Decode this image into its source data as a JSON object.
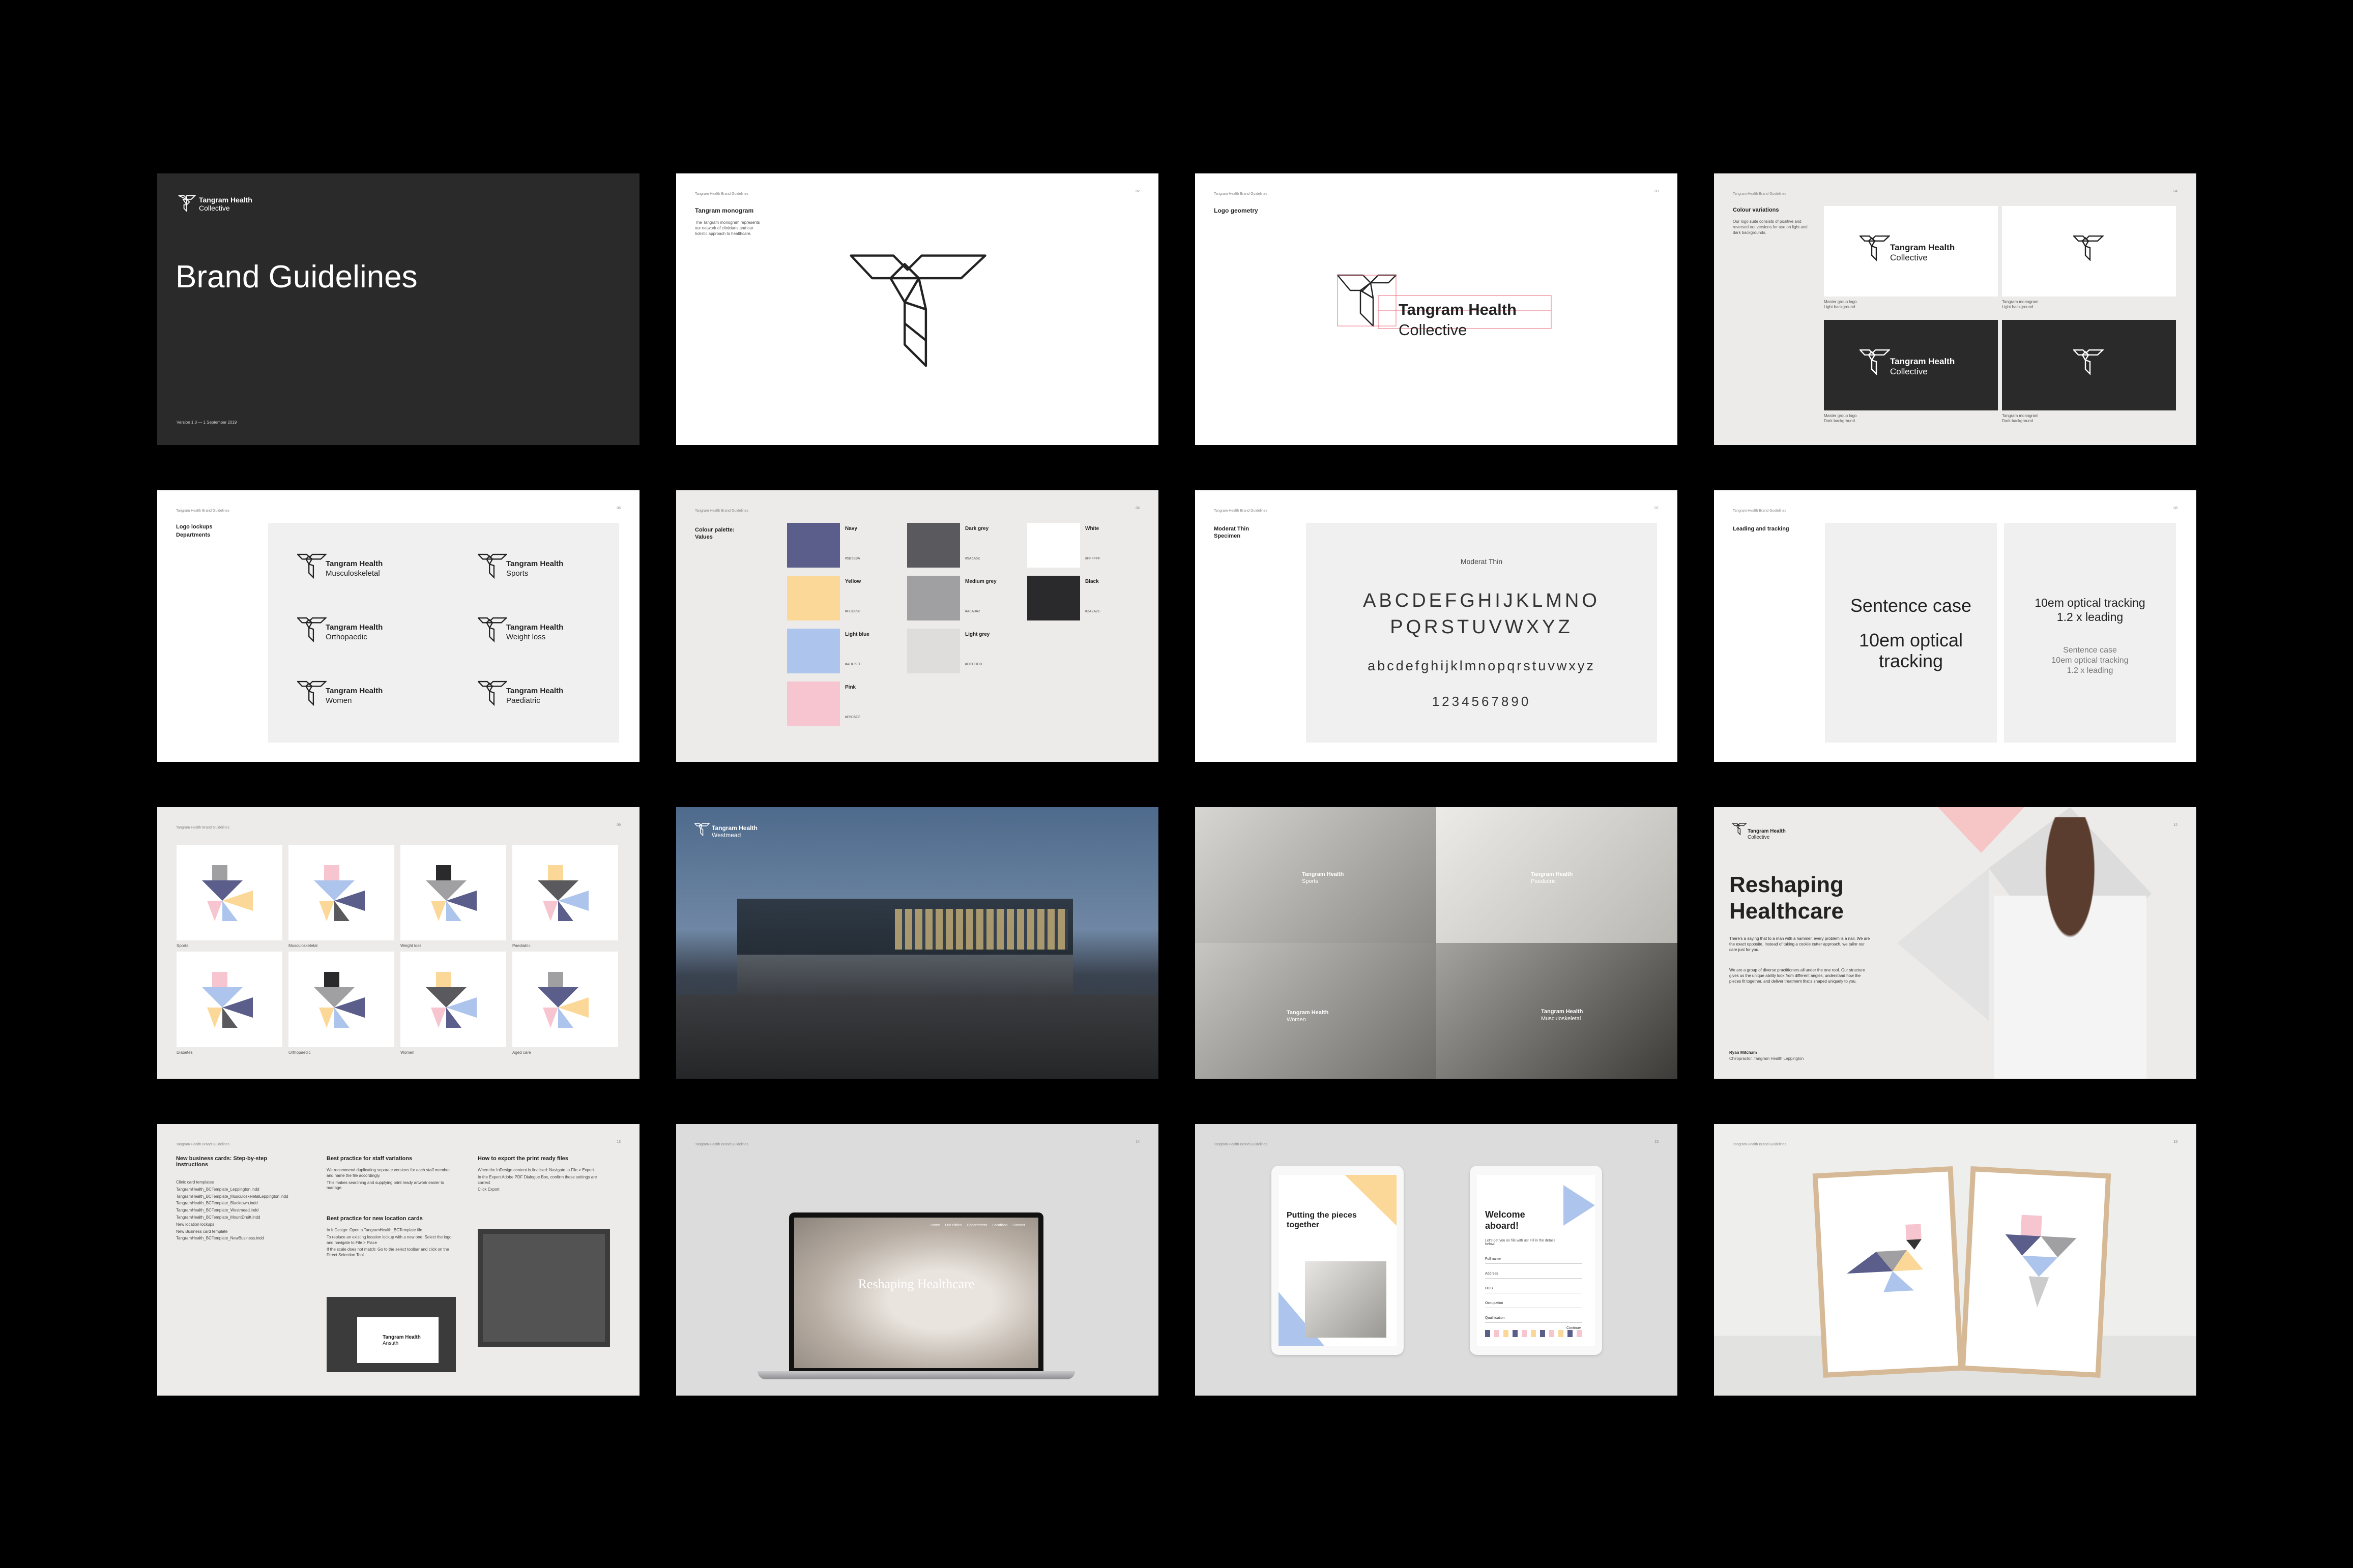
{
  "brand": {
    "name_line1": "Tangram Health",
    "name_line2": "Collective",
    "header": "Tangram Health Brand Guidelines"
  },
  "cover": {
    "title": "Brand Guidelines",
    "version": "Version 1.0 — 1 September 2019"
  },
  "monogram": {
    "section": "Logo",
    "title": "Tangram monogram",
    "desc": "The Tangram monogram represents our network of clinicians and our holistic approach to healthcare."
  },
  "geometry": {
    "title": "Logo geometry"
  },
  "colour_variations": {
    "title": "Colour variations",
    "desc": "Our logo suite consists of positive and reversed out versions for use on light and dark backgrounds.",
    "cap1": "Master group logo",
    "cap1b": "Light background",
    "cap2": "Tangram monogram",
    "cap2b": "Light background",
    "cap3": "Master group logo",
    "cap3b": "Dark background",
    "cap4": "Tangram monogram",
    "cap4b": "Dark background"
  },
  "lockups": {
    "section": "Logo",
    "title": "Logo lockups",
    "subtitle": "Departments",
    "items": [
      "Musculoskeletal",
      "Sports",
      "Orthopaedic",
      "Weight loss",
      "Women",
      "Paediatric"
    ]
  },
  "palette": {
    "section": "Colour",
    "title": "Colour palette:",
    "subtitle": "Values",
    "colors": {
      "navy": "#5B5E8A",
      "yellow": "#FCD898",
      "lightblue": "#ADC5EC",
      "pink": "#F6C5CF",
      "darkgrey": "#5A5A5E",
      "mediumgrey": "#A0A0A2",
      "lightgrey": "#DEDDDB",
      "white": "#FFFFFF",
      "black": "#2A2A2C"
    },
    "names": {
      "navy": "Navy",
      "yellow": "Yellow",
      "lightblue": "Light blue",
      "pink": "Pink",
      "darkgrey": "Dark grey",
      "mediumgrey": "Medium grey",
      "lightgrey": "Light grey",
      "white": "White",
      "black": "Black"
    }
  },
  "typography": {
    "section": "Typography",
    "title": "Moderat Thin",
    "subtitle": "Specimen",
    "font_name": "Moderat Thin",
    "upper1": "ABCDEFGHIJKLMNO",
    "upper2": "PQRSTUVWXYZ",
    "lower": "abcdefghijklmnopqrstuvwxyz",
    "digits": "1234567890"
  },
  "leading": {
    "section": "Typography",
    "title": "Leading and tracking",
    "sc": "Sentence case",
    "opt": "10em optical tracking",
    "r1": "10em optical tracking",
    "r2": "1.2 x leading",
    "s1": "Sentence case",
    "s2": "10em optical tracking",
    "s3": "1.2 x leading"
  },
  "illustrations": {
    "section": "Department illustrations",
    "labels": [
      "Sports",
      "Musculoskeletal",
      "Weight loss",
      "Paediatric",
      "Diabetes",
      "Orthopaedic",
      "Women",
      "Aged care"
    ]
  },
  "building": {
    "line1": "Tangram Health",
    "line2": "Westmead"
  },
  "photos": {
    "labels": [
      "Sports",
      "Paediatric",
      "Women",
      "Musculoskeletal"
    ]
  },
  "reshaping": {
    "title1": "Reshaping",
    "title2": "Healthcare",
    "p1": "There's a saying that to a man with a hammer, every problem is a nail. We are the exact opposite. Instead of taking a cookie cutter approach, we tailor our care just for you.",
    "p2": "We are a group of diverse practitioners all under the one roof. Our structure gives us the unique ability look from different angles, understand how the pieces fit together, and deliver treatment that's shaped uniquely to you.",
    "sign1": "Ryan Mitcham",
    "sign2": "Chiropractor, Tangram Health Leppington"
  },
  "business_cards": {
    "section": "Business cards / new variations",
    "col1_title": "New business cards: Step-by-step instructions",
    "col1_items": [
      "Clinic card templates",
      "TangramHealth_BCTemplate_Leppington.indd",
      "TangramHealth_BCTemplate_MusculoskeletalLeppington.indd",
      "TangramHealth_BCTemplate_Blacktown.indd",
      "TangramHealth_BCTemplate_Westmead.indd",
      "TangramHealth_BCTemplate_MountDruitt.indd",
      "New location lockups",
      "New Business card template",
      "TangramHealth_BCTemplate_NewBusiness.indd"
    ],
    "col2_title": "Best practice for staff variations",
    "col2_items": [
      "We recommend duplicating separate versions for each staff member, and name the file accordingly.",
      "This makes searching and supplying print ready artwork easier to manage."
    ],
    "col2b_title": "Best practice for new location cards",
    "col2b_items": [
      "In InDesign: Open a TangramHealth_BCTemplate file",
      "To replace an existing location lockup with a new one: Select the logo and navigate to File > Place",
      "If the scale does not match: Go to the select toolbar and click on the Direct Selection Tool."
    ],
    "col3_title": "How to export the print ready files",
    "col3_items": [
      "When the InDesign content is finalised: Navigate to File > Export.",
      "In the Export Adobe PDF Dialogue Box, confirm these settings are correct",
      "Click Export"
    ],
    "mock_logo1": "Tangram Health",
    "mock_logo2": "Ansuth"
  },
  "homepage": {
    "section": "Homepage",
    "hero": "Reshaping Healthcare",
    "nav": [
      "Home",
      "Our clinics",
      "Departments",
      "Locations",
      "Contact"
    ]
  },
  "digital": {
    "section": "Digital",
    "tab1_title": "Putting the pieces together",
    "tab2_title": "Welcome aboard!",
    "tab2_sub": "Let's get you on file with us! Fill in the details below.",
    "fields": [
      "Full name",
      "Address",
      "DOB",
      "Occupation",
      "Qualification"
    ],
    "next": "Continue"
  },
  "posters": {
    "section": "Posters"
  },
  "page_nums": [
    "01",
    "02",
    "03",
    "04",
    "05",
    "06",
    "07",
    "08",
    "09",
    "10",
    "11",
    "12",
    "13",
    "14",
    "15"
  ]
}
